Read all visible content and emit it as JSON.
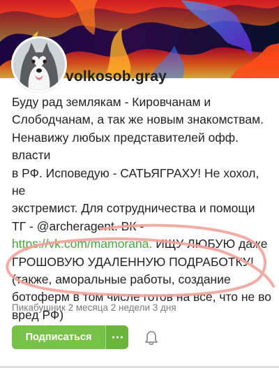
{
  "profile": {
    "username": "volkosob.gray",
    "bio_lines": [
      "Буду рад землякам - Кировчанам и",
      "Слободчанам, а так же новым знакомствам.",
      "Ненавижу любых представителей офф. власти",
      "в РФ. Исповедую - САТЬЯГРАХУ! Не хохол, не",
      "экстремист. Для сотрудничества и помощи",
      "ТГ - @archeragent. ВК -"
    ],
    "bio_link": "https://vk.com/mamorana.",
    "bio_after_link": " ИЩУ ЛЮБУЮ даже",
    "bio_tail_lines": [
      "ГРОШОВУЮ УДАЛЕННУЮ ПОДРАБОТКУ!",
      "(также, аморальные работы, создание",
      "ботоферм в том числе готов на все, что не во",
      "вред РФ)"
    ],
    "member_since": "Пикабушник 2 месяца 2 недели 3 дня"
  },
  "actions": {
    "subscribe_label": "Подписаться",
    "more_label": "⋯"
  },
  "icons": {
    "more": "more-icon",
    "bell": "bell-icon",
    "avatar": "husky-avatar"
  },
  "colors": {
    "accent_green": "#78c14a",
    "link_green": "#4aa53c",
    "scribble": "#f2a29a"
  }
}
